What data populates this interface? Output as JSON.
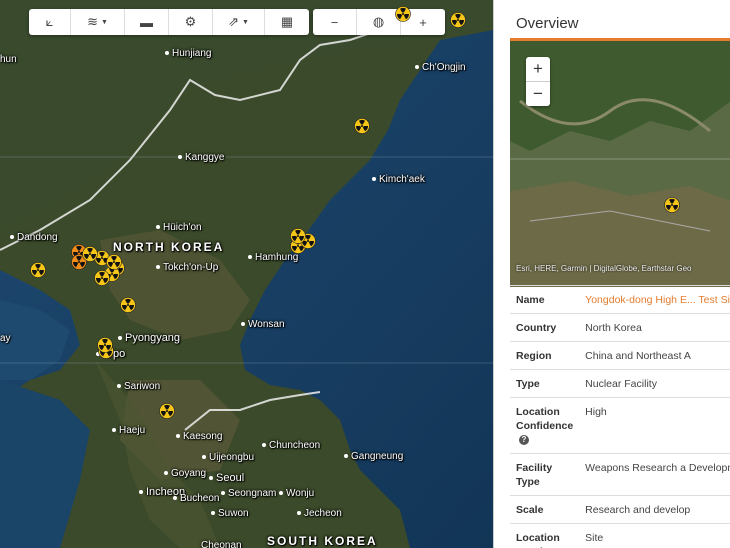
{
  "toolbar": {
    "group1": [
      {
        "name": "measure-tool-button",
        "icon": "⟀",
        "caret": false,
        "width": 42
      },
      {
        "name": "layers-button",
        "icon": "≋",
        "caret": true,
        "width": 54
      },
      {
        "name": "open-folder-button",
        "icon": "▬",
        "caret": false,
        "width": 44
      },
      {
        "name": "settings-button",
        "icon": "⚙",
        "caret": false,
        "width": 44
      },
      {
        "name": "share-button",
        "icon": "⇗",
        "caret": true,
        "width": 52
      },
      {
        "name": "calendar-button",
        "icon": "▦",
        "caret": false,
        "width": 44
      }
    ],
    "group2": [
      {
        "name": "zoom-out-button",
        "icon": "−",
        "caret": false,
        "width": 44
      },
      {
        "name": "globe-button",
        "icon": "◍",
        "caret": false,
        "width": 44
      },
      {
        "name": "zoom-in-button",
        "icon": "+",
        "caret": false,
        "width": 44
      }
    ]
  },
  "map": {
    "labels": [
      {
        "text": "Hunjiang",
        "style": "",
        "dot": true
      },
      {
        "text": "hun",
        "style": "",
        "dot": false
      },
      {
        "text": "Ch'Ongjin",
        "style": "",
        "dot": true
      },
      {
        "text": "Kanggye",
        "style": "",
        "dot": true
      },
      {
        "text": "Kimch'aek",
        "style": "",
        "dot": true
      },
      {
        "text": "Hüich'on",
        "style": "",
        "dot": true
      },
      {
        "text": "Dandong",
        "style": "",
        "dot": true
      },
      {
        "text": "NORTH KOREA",
        "style": "big",
        "dot": false
      },
      {
        "text": "Hamhung",
        "style": "",
        "dot": true
      },
      {
        "text": "Tokch'on-Up",
        "style": "",
        "dot": true
      },
      {
        "text": "Pyongyang",
        "style": "med",
        "dot": true
      },
      {
        "text": "Wonsan",
        "style": "",
        "dot": true
      },
      {
        "text": "N'po",
        "style": "med",
        "dot": true
      },
      {
        "text": "Sariwon",
        "style": "",
        "dot": true
      },
      {
        "text": "Haeju",
        "style": "",
        "dot": true
      },
      {
        "text": "Kaesong",
        "style": "",
        "dot": true
      },
      {
        "text": "Chuncheon",
        "style": "",
        "dot": true
      },
      {
        "text": "Uijeongbu",
        "style": "",
        "dot": true
      },
      {
        "text": "Gangneung",
        "style": "",
        "dot": true
      },
      {
        "text": "Goyang",
        "style": "",
        "dot": true
      },
      {
        "text": "Seoul",
        "style": "med",
        "dot": true
      },
      {
        "text": "Incheon",
        "style": "med",
        "dot": true
      },
      {
        "text": "Seongnam",
        "style": "",
        "dot": true
      },
      {
        "text": "Bucheon",
        "style": "",
        "dot": true
      },
      {
        "text": "Wonju",
        "style": "",
        "dot": true
      },
      {
        "text": "Jecheon",
        "style": "",
        "dot": true
      },
      {
        "text": "Suwon",
        "style": "",
        "dot": true
      },
      {
        "text": "Cheonan",
        "style": "",
        "dot": false
      },
      {
        "text": "SOUTH KOREA",
        "style": "big",
        "dot": false
      },
      {
        "text": "ay",
        "style": "",
        "dot": false
      }
    ],
    "markers_count": 19
  },
  "panel": {
    "title": "Overview",
    "zoom_in": "+",
    "zoom_out": "−",
    "attribution": "Esri, HERE, Garmin | DigitalGlobe, Earthstar Geo",
    "rows": [
      {
        "key": "Name",
        "value": "Yongdok-dong High E... Test Site",
        "link": true,
        "help": false
      },
      {
        "key": "Country",
        "value": "North Korea",
        "link": false,
        "help": false
      },
      {
        "key": "Region",
        "value": "China and Northeast A",
        "link": false,
        "help": false
      },
      {
        "key": "Type",
        "value": "Nuclear Facility",
        "link": false,
        "help": false
      },
      {
        "key": "Location Confidence",
        "value": "High",
        "link": false,
        "help": true
      },
      {
        "key": "Facility Type",
        "value": "Weapons Research a Development",
        "link": false,
        "help": false
      },
      {
        "key": "Scale",
        "value": "Research and develop",
        "link": false,
        "help": false
      },
      {
        "key": "Location Level",
        "value": "Site",
        "link": false,
        "help": false
      }
    ]
  },
  "colors": {
    "accent": "#e47d2e",
    "marker_yellow": "#f5c518",
    "marker_orange": "#f08c1a"
  }
}
